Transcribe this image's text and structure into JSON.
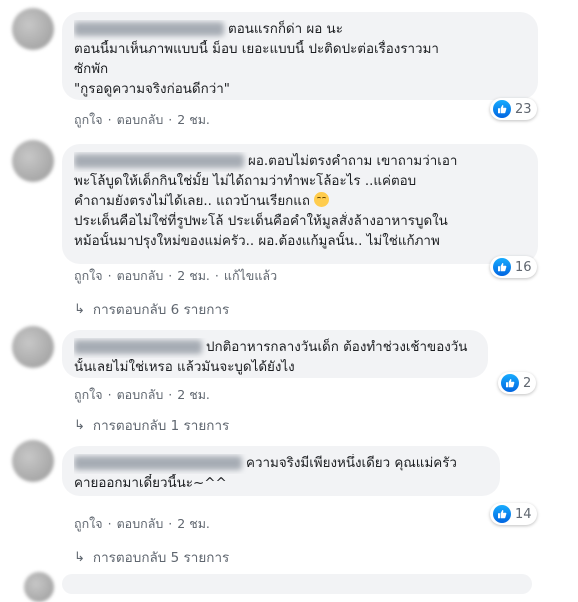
{
  "colors": {
    "bubble_bg": "#f2f3f5",
    "like_blue": "#1877f2",
    "meta_gray": "#606770"
  },
  "comments": [
    {
      "lines": [
        "ตอนแรกก็ด่า ผอ นะ",
        "ตอนนี้มาเห็นภาพแบบนี้ ม็อบ เยอะแบบนี้ ปะติดปะต่อเรื่องราวมา",
        "ซักพัก",
        "\"กูรอดูความจริงก่อนดีกว่า\""
      ],
      "reaction_count": "23",
      "actions": {
        "like": "ถูกใจ",
        "reply": "ตอบกลับ",
        "time": "2 ชม."
      }
    },
    {
      "lines": [
        "ผอ.ตอบไม่ตรงคำถาม เขาถามว่าเอา",
        "พะโล้บูดให้เด็กกินใช่มั้ย ไม่ได้ถามว่าทำพะโล้อะไร ..แค่ตอบ",
        "คำถามยังตรงไม่ได้เลย.. แถวบ้านเรียกแถ",
        "ประเด็นคือไม่ใช่ที่รูปพะโล้ ประเด็นคือคำให้มูลสั่งล้างอาหารบูดใน",
        "หม้อนั้นมาปรุงใหม่ของแม่ครัว.. ผอ.ต้องแก้มูลนั้น.. ไม่ใช่แก้ภาพ"
      ],
      "reaction_count": "16",
      "actions": {
        "like": "ถูกใจ",
        "reply": "ตอบกลับ",
        "time": "2 ชม.",
        "edited": "แก้ไขแล้ว"
      },
      "replies_label": "การตอบกลับ 6 รายการ"
    },
    {
      "lines": [
        "ปกติอาหารกลางวันเด็ก ต้องทำช่วงเช้าของวัน",
        "นั้นเลยไม่ใช่เหรอ แล้วมันจะบูดได้ยังไง"
      ],
      "reaction_count": "2",
      "actions": {
        "like": "ถูกใจ",
        "reply": "ตอบกลับ",
        "time": "2 ชม."
      },
      "replies_label": "การตอบกลับ 1 รายการ"
    },
    {
      "lines": [
        "ความจริงมีเพียงหนึ่งเดียว คุณแม่ครัว",
        "คายออกมาเดี๋ยวนี้นะ~^^"
      ],
      "reaction_count": "14",
      "actions": {
        "like": "ถูกใจ",
        "reply": "ตอบกลับ",
        "time": "2 ชม."
      },
      "replies_label": "การตอบกลับ 5 รายการ"
    }
  ]
}
